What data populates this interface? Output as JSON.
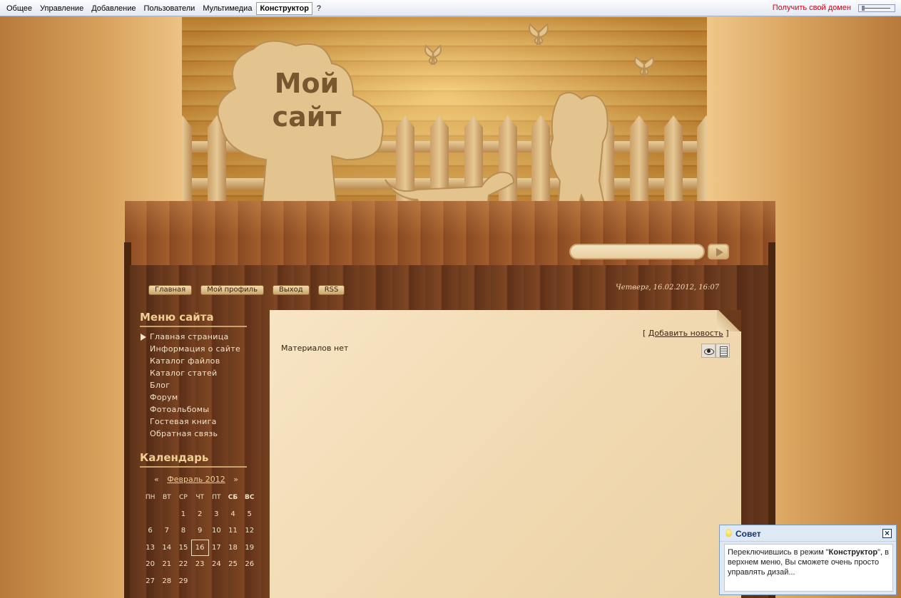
{
  "topbar": {
    "menu": [
      "Общее",
      "Управление",
      "Добавление",
      "Пользователи",
      "Мультимедиа",
      "Конструктор",
      "?"
    ],
    "active_index": 5,
    "domain_link": "Получить свой домен"
  },
  "header": {
    "title_line1": "Мой",
    "title_line2": "сайт"
  },
  "nav": {
    "buttons": [
      "Главная",
      "Мой профиль",
      "Выход",
      "RSS"
    ],
    "date": "Четверг, 16.02.2012, 16:07"
  },
  "sidebar": {
    "menu_title": "Меню сайта",
    "menu_items": [
      "Главная страница",
      "Информация о сайте",
      "Каталог файлов",
      "Каталог статей",
      "Блог",
      "Форум",
      "Фотоальбомы",
      "Гостевая книга",
      "Обратная связь"
    ],
    "calendar_title": "Календарь",
    "calendar": {
      "prev": "«",
      "month": "Февраль 2012",
      "next": "»",
      "weekdays": [
        "ПН",
        "ВТ",
        "СР",
        "ЧТ",
        "ПТ",
        "СБ",
        "ВС"
      ],
      "weeks": [
        [
          "",
          "",
          "1",
          "2",
          "3",
          "4",
          "5"
        ],
        [
          "6",
          "7",
          "8",
          "9",
          "10",
          "11",
          "12"
        ],
        [
          "13",
          "14",
          "15",
          "16",
          "17",
          "18",
          "19"
        ],
        [
          "20",
          "21",
          "22",
          "23",
          "24",
          "25",
          "26"
        ],
        [
          "27",
          "28",
          "29",
          "",
          "",
          "",
          ""
        ]
      ],
      "today": "16"
    }
  },
  "content": {
    "add_news_open": "[",
    "add_news_link": "Добавить новость",
    "add_news_close": "]",
    "empty_text": "Материалов нет",
    "icons": [
      "eye-icon",
      "doc-icon"
    ]
  },
  "tip": {
    "title": "Совет",
    "close": "×",
    "text_before": "Переключившись в режим \"",
    "text_bold": "Конструктор",
    "text_after": "\", в верхнем меню, Вы сможете очень просто управлять дизай..."
  },
  "colors": {
    "accent_text": "#f0cf92",
    "domain_link": "#d0021b",
    "paper": "#f7e5c4"
  }
}
